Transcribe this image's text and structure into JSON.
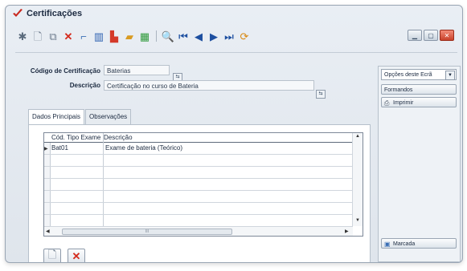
{
  "window": {
    "title": "Certificações",
    "controls": [
      "minimize",
      "maximize",
      "close"
    ]
  },
  "toolbar": {
    "icons": [
      "settings-icon",
      "new-doc-icon",
      "copy-doc-icon",
      "delete-icon",
      "tool-icon",
      "chart-icon",
      "flag-icon",
      "export-icon",
      "grid-icon",
      "print-preview-icon",
      "nav-first-icon",
      "nav-prev-icon",
      "nav-next-icon",
      "nav-last-icon",
      "refresh-icon"
    ]
  },
  "form": {
    "code_label": "Código de Certificação",
    "code_value": "Baterias",
    "description_label": "Descrição",
    "description_value": "Certificação no curso de Bateria"
  },
  "tabs": [
    {
      "label": "Dados Principais",
      "active": true
    },
    {
      "label": "Observações",
      "active": false
    }
  ],
  "grid": {
    "columns": [
      "Cód. Tipo Exame",
      "Descrição"
    ],
    "rows": [
      {
        "code": "Bat01",
        "description": "Exame de bateria (Teórico)"
      }
    ],
    "scroll_label": "III"
  },
  "right_panel": {
    "options_label": "Opções deste Ecrã",
    "buttons": [
      {
        "label": "Formandos"
      },
      {
        "label": "Imprimir"
      },
      {
        "label": "Marcada"
      }
    ]
  }
}
